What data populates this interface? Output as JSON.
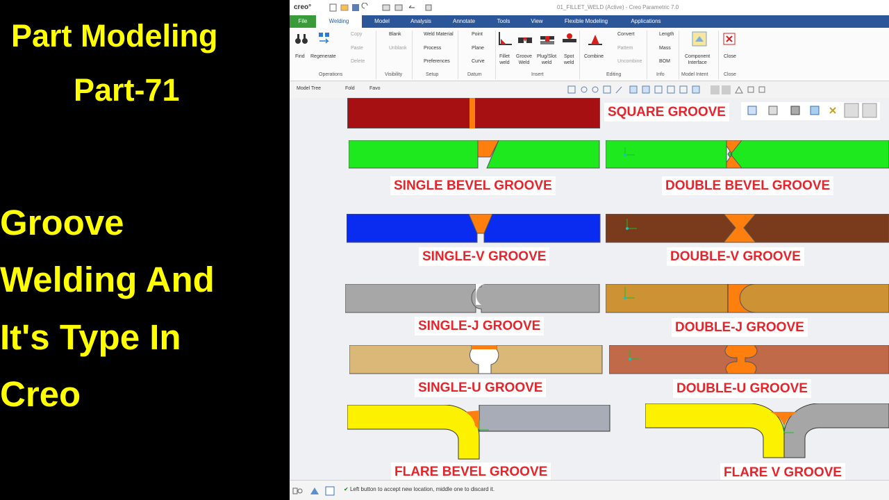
{
  "overlay": {
    "series_title_line1": "Part Modeling",
    "series_title_line2": "Part-71",
    "topic_line1": "Groove",
    "topic_line2": "Welding And",
    "topic_line3": "It's Type In",
    "topic_line4": "Creo"
  },
  "window": {
    "title": "01_FILLET_WELD (Active) - Creo Parametric 7.0",
    "logo": "creo°"
  },
  "tabs": [
    "File",
    "Welding",
    "Model",
    "Analysis",
    "Annotate",
    "Tools",
    "View",
    "Flexible Modeling",
    "Applications"
  ],
  "ribbon": {
    "find": "Find",
    "regenerate": "Regenerate",
    "copy": "Copy",
    "paste": "Paste",
    "delete": "Delete",
    "operations": "Operations",
    "blank": "Blank",
    "unblank": "Unblank",
    "visibility": "Visibility",
    "weld_material": "Weld Material",
    "process": "Process",
    "preferences": "Preferences",
    "setup": "Setup",
    "point": "Point",
    "plane": "Plane",
    "curve": "Curve",
    "datum": "Datum",
    "fillet_weld_1": "Fillet",
    "fillet_weld_2": "weld",
    "groove_weld_1": "Groove",
    "groove_weld_2": "Weld",
    "plug_slot_1": "Plug/Slot",
    "plug_slot_2": "weld",
    "spot_weld_1": "Spot",
    "spot_weld_2": "weld",
    "insert": "Insert",
    "combine": "Combine",
    "convert": "Convert",
    "pattern": "Pattern",
    "uncombine": "Uncombine",
    "editing": "Editing",
    "length": "Length",
    "mass": "Mass",
    "bom": "BOM",
    "info": "Info",
    "component_interface_1": "Component",
    "component_interface_2": "Interface",
    "model_intent": "Model Intent",
    "close": "Close",
    "close_group": "Close"
  },
  "tree_tabs": [
    "Model Tree",
    "Fold",
    "Favo"
  ],
  "grooves": {
    "square": "SQUARE GROOVE",
    "single_bevel": "SINGLE BEVEL GROOVE",
    "double_bevel": "DOUBLE BEVEL GROOVE",
    "single_v": "SINGLE-V GROOVE",
    "double_v": "DOUBLE-V GROOVE",
    "single_j": "SINGLE-J GROOVE",
    "double_j": "DOUBLE-J GROOVE",
    "single_u": "SINGLE-U GROOVE",
    "double_u": "DOUBLE-U GROOVE",
    "flare_bevel": "FLARE BEVEL GROOVE",
    "flare_v": "FLARE V GROOVE"
  },
  "status": {
    "message": "Left button to accept new location, middle one to discard it."
  },
  "colors": {
    "overlay_text": "#ffff00",
    "tab_bar": "#2b579a",
    "file_tab": "#3a9b3a",
    "label_text": "#e8232a",
    "weld": "#ff7f0e"
  }
}
